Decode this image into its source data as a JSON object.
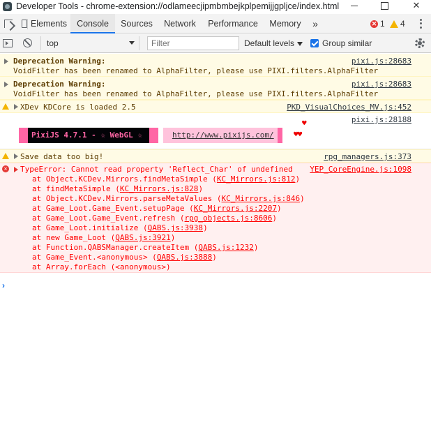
{
  "window": {
    "title": "Developer Tools - chrome-extension://odlameecjipmbmbejkplpemijjgpljce/index.html"
  },
  "tabs": {
    "elements": "Elements",
    "console": "Console",
    "sources": "Sources",
    "network": "Network",
    "performance": "Performance",
    "memory": "Memory",
    "more": "»"
  },
  "badges": {
    "errors": "1",
    "warnings": "4"
  },
  "toolbar": {
    "context": "top",
    "filter_placeholder": "Filter",
    "levels": "Default levels",
    "group_similar": "Group similar"
  },
  "messages": {
    "dep1": {
      "title": "Deprecation Warning:",
      "body": "VoidFilter has been renamed to AlphaFilter, please use PIXI.filters.AlphaFilter",
      "source": "pixi.js:28683"
    },
    "dep2": {
      "title": "Deprecation Warning:",
      "body": "VoidFilter has been renamed to AlphaFilter, please use PIXI.filters.AlphaFilter",
      "source": "pixi.js:28683"
    },
    "kdcore": {
      "text": "XDev KDCore is loaded 2.5",
      "source": "PKD_VisualChoices_MV.js:452"
    },
    "pixi": {
      "source": "pixi.js:28188",
      "banner_text": "PixiJS 4.7.1 - ☆ WebGL ☆",
      "banner_link": "http://www.pixijs.com/",
      "heart_top": "♥",
      "hearts_bottom": "♥♥"
    },
    "save": {
      "text": "Save data too big!",
      "source": "rpg_managers.js:373"
    },
    "error": {
      "head": "TypeError: Cannot read property 'Reflect_Char' of undefined",
      "source": "YEP_CoreEngine.js:1098",
      "stack": [
        {
          "pre": "at Object.KCDev.Mirrors.findMetaSimple (",
          "file": "KC_Mirrors.js:812",
          "post": ")"
        },
        {
          "pre": "at findMetaSimple (",
          "file": "KC_Mirrors.js:828",
          "post": ")"
        },
        {
          "pre": "at Object.KCDev.Mirrors.parseMetaValues (",
          "file": "KC_Mirrors.js:846",
          "post": ")"
        },
        {
          "pre": "at Game_Loot.Game_Event.setupPage (",
          "file": "KC_Mirrors.js:2207",
          "post": ")"
        },
        {
          "pre": "at Game_Loot.Game_Event.refresh (",
          "file": "rpg_objects.js:8606",
          "post": ")"
        },
        {
          "pre": "at Game_Loot.initialize (",
          "file": "QABS.js:3938",
          "post": ")"
        },
        {
          "pre": "at new Game_Loot (",
          "file": "QABS.js:3921",
          "post": ")"
        },
        {
          "pre": "at Function.QABSManager.createItem (",
          "file": "QABS.js:1232",
          "post": ")"
        },
        {
          "pre": "at Game_Event.<anonymous> (",
          "file": "QABS.js:3888",
          "post": ")"
        },
        {
          "pre": "at Array.forEach (<anonymous>)",
          "file": "",
          "post": ""
        }
      ]
    }
  },
  "prompt": "›",
  "colors": {
    "accent": "#1a73e8",
    "error": "#ff0000",
    "warning_bg": "#fffbe5",
    "error_bg": "#fff0f0",
    "pixi_pink": "#ff66a5"
  }
}
